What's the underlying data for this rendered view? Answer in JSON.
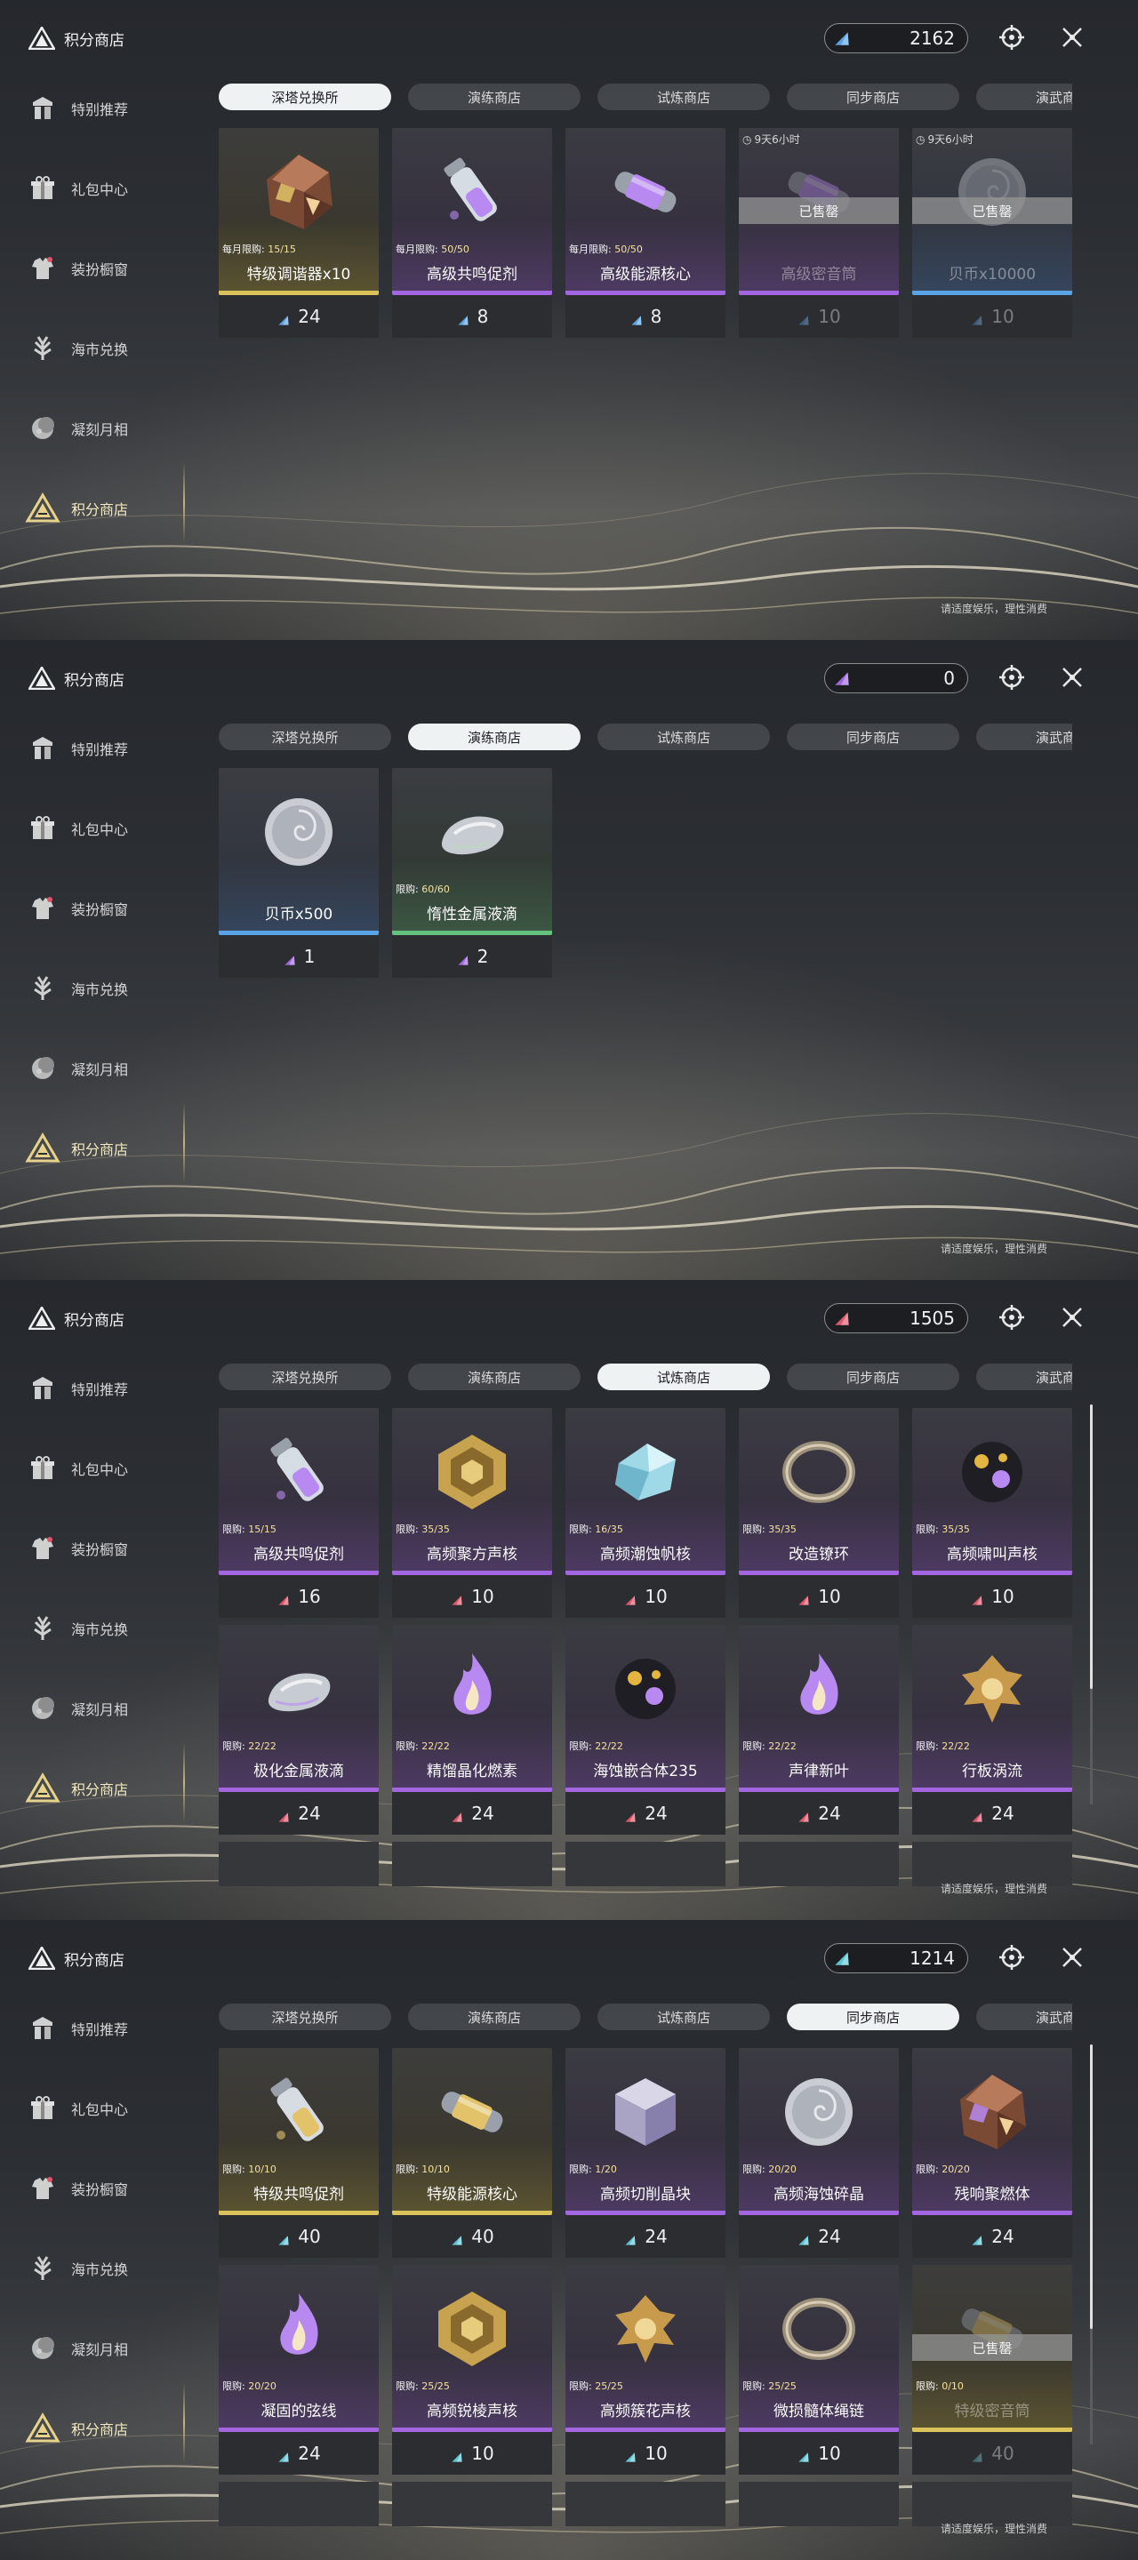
{
  "footer_note": "请适度娱乐，理性消费",
  "colors": {
    "gold": "#d9c35a",
    "purple": "#a466e0",
    "blue": "#5aa3e6",
    "green": "#64c27e",
    "red": "#e0566b",
    "cyan": "#5fc6d6"
  },
  "panels": [
    {
      "title": "积分商店",
      "currency": {
        "value": "2162",
        "icon": "blue-crystal-icon",
        "color": "#5aa3e6"
      },
      "sidebar": [
        "特别推荐",
        "礼包中心",
        "装扮橱窗",
        "海市兑换",
        "凝刻月相",
        "积分商店"
      ],
      "tabs": [
        "深塔兑换所",
        "演练商店",
        "试炼商店",
        "同步商店",
        "演武商店"
      ],
      "active_tab": 0,
      "items": [
        {
          "name": "特级调谐器x10",
          "limit_label": "每月限购:",
          "limit": "15/15",
          "price": "24",
          "rarity": "gold",
          "art": "crystal"
        },
        {
          "name": "高级共鸣促剂",
          "limit_label": "每月限购:",
          "limit": "50/50",
          "price": "8",
          "rarity": "purple",
          "art": "vial"
        },
        {
          "name": "高级能源核心",
          "limit_label": "每月限购:",
          "limit": "50/50",
          "price": "8",
          "rarity": "purple",
          "art": "capsule"
        },
        {
          "name": "高级密音筒",
          "timer": "9天6小时",
          "sold": "已售罄",
          "price": "10",
          "rarity": "purple",
          "art": "capsule"
        },
        {
          "name": "贝币x10000",
          "timer": "9天6小时",
          "sold": "已售罄",
          "price": "10",
          "rarity": "blue",
          "art": "coin"
        }
      ]
    },
    {
      "title": "积分商店",
      "currency": {
        "value": "0",
        "icon": "purple-crystal-icon",
        "color": "#a466e0"
      },
      "sidebar": [
        "特别推荐",
        "礼包中心",
        "装扮橱窗",
        "海市兑换",
        "凝刻月相",
        "积分商店"
      ],
      "tabs": [
        "深塔兑换所",
        "演练商店",
        "试炼商店",
        "同步商店",
        "演武商店"
      ],
      "active_tab": 1,
      "items": [
        {
          "name": "贝币x500",
          "price": "1",
          "rarity": "blue",
          "art": "coin"
        },
        {
          "name": "惰性金属液滴",
          "limit_label": "限购:",
          "limit": "60/60",
          "price": "2",
          "rarity": "green",
          "art": "droplet"
        }
      ]
    },
    {
      "title": "积分商店",
      "currency": {
        "value": "1505",
        "icon": "red-crystal-icon",
        "color": "#e0566b"
      },
      "sidebar": [
        "特别推荐",
        "礼包中心",
        "装扮橱窗",
        "海市兑换",
        "凝刻月相",
        "积分商店"
      ],
      "tabs": [
        "深塔兑换所",
        "演练商店",
        "试炼商店",
        "同步商店",
        "演武商店"
      ],
      "active_tab": 2,
      "items": [
        {
          "name": "高级共鸣促剂",
          "limit_label": "限购:",
          "limit": "15/15",
          "price": "16",
          "rarity": "purple",
          "art": "vial"
        },
        {
          "name": "高频聚方声核",
          "limit_label": "限购:",
          "limit": "35/35",
          "price": "10",
          "rarity": "purple",
          "art": "hexgold"
        },
        {
          "name": "高频潮蚀帆核",
          "limit_label": "限购:",
          "limit": "16/35",
          "price": "10",
          "rarity": "purple",
          "art": "ice"
        },
        {
          "name": "改造镣环",
          "limit_label": "限购:",
          "limit": "35/35",
          "price": "10",
          "rarity": "purple",
          "art": "ring"
        },
        {
          "name": "高频啸叫声核",
          "limit_label": "限购:",
          "limit": "35/35",
          "price": "10",
          "rarity": "purple",
          "art": "orb"
        },
        {
          "name": "极化金属液滴",
          "limit_label": "限购:",
          "limit": "22/22",
          "price": "24",
          "rarity": "purple",
          "art": "droplet"
        },
        {
          "name": "精馏晶化燃素",
          "limit_label": "限购:",
          "limit": "22/22",
          "price": "24",
          "rarity": "purple",
          "art": "flame"
        },
        {
          "name": "海蚀嵌合体235",
          "limit_label": "限购:",
          "limit": "22/22",
          "price": "24",
          "rarity": "purple",
          "art": "orb"
        },
        {
          "name": "声律新叶",
          "limit_label": "限购:",
          "limit": "22/22",
          "price": "24",
          "rarity": "purple",
          "art": "flame"
        },
        {
          "name": "行板涡流",
          "limit_label": "限购:",
          "limit": "22/22",
          "price": "24",
          "rarity": "purple",
          "art": "spiral"
        }
      ]
    },
    {
      "title": "积分商店",
      "currency": {
        "value": "1214",
        "icon": "cyan-crystal-icon",
        "color": "#5fc6d6"
      },
      "sidebar": [
        "特别推荐",
        "礼包中心",
        "装扮橱窗",
        "海市兑换",
        "凝刻月相",
        "积分商店"
      ],
      "tabs": [
        "深塔兑换所",
        "演练商店",
        "试炼商店",
        "同步商店",
        "演武商店"
      ],
      "active_tab": 3,
      "items": [
        {
          "name": "特级共鸣促剂",
          "limit_label": "限购:",
          "limit": "10/10",
          "price": "40",
          "rarity": "gold",
          "art": "vial"
        },
        {
          "name": "特级能源核心",
          "limit_label": "限购:",
          "limit": "10/10",
          "price": "40",
          "rarity": "gold",
          "art": "capsule"
        },
        {
          "name": "高频切削晶块",
          "limit_label": "限购:",
          "limit": "1/20",
          "price": "24",
          "rarity": "purple",
          "art": "cube"
        },
        {
          "name": "高频海蚀碎晶",
          "limit_label": "限购:",
          "limit": "20/20",
          "price": "24",
          "rarity": "purple",
          "art": "coin"
        },
        {
          "name": "残响聚燃体",
          "limit_label": "限购:",
          "limit": "20/20",
          "price": "24",
          "rarity": "purple",
          "art": "crystal"
        },
        {
          "name": "凝固的弦线",
          "limit_label": "限购:",
          "limit": "20/20",
          "price": "24",
          "rarity": "purple",
          "art": "flame"
        },
        {
          "name": "高频锐棱声核",
          "limit_label": "限购:",
          "limit": "25/25",
          "price": "10",
          "rarity": "purple",
          "art": "hexgold"
        },
        {
          "name": "高频簇花声核",
          "limit_label": "限购:",
          "limit": "25/25",
          "price": "10",
          "rarity": "purple",
          "art": "spiral"
        },
        {
          "name": "微损髓体绳链",
          "limit_label": "限购:",
          "limit": "25/25",
          "price": "10",
          "rarity": "purple",
          "art": "ring"
        },
        {
          "name": "特级密音筒",
          "sold": "已售罄",
          "limit_label": "限购:",
          "limit": "0/10",
          "price": "40",
          "rarity": "gold",
          "art": "capsule"
        }
      ]
    }
  ]
}
